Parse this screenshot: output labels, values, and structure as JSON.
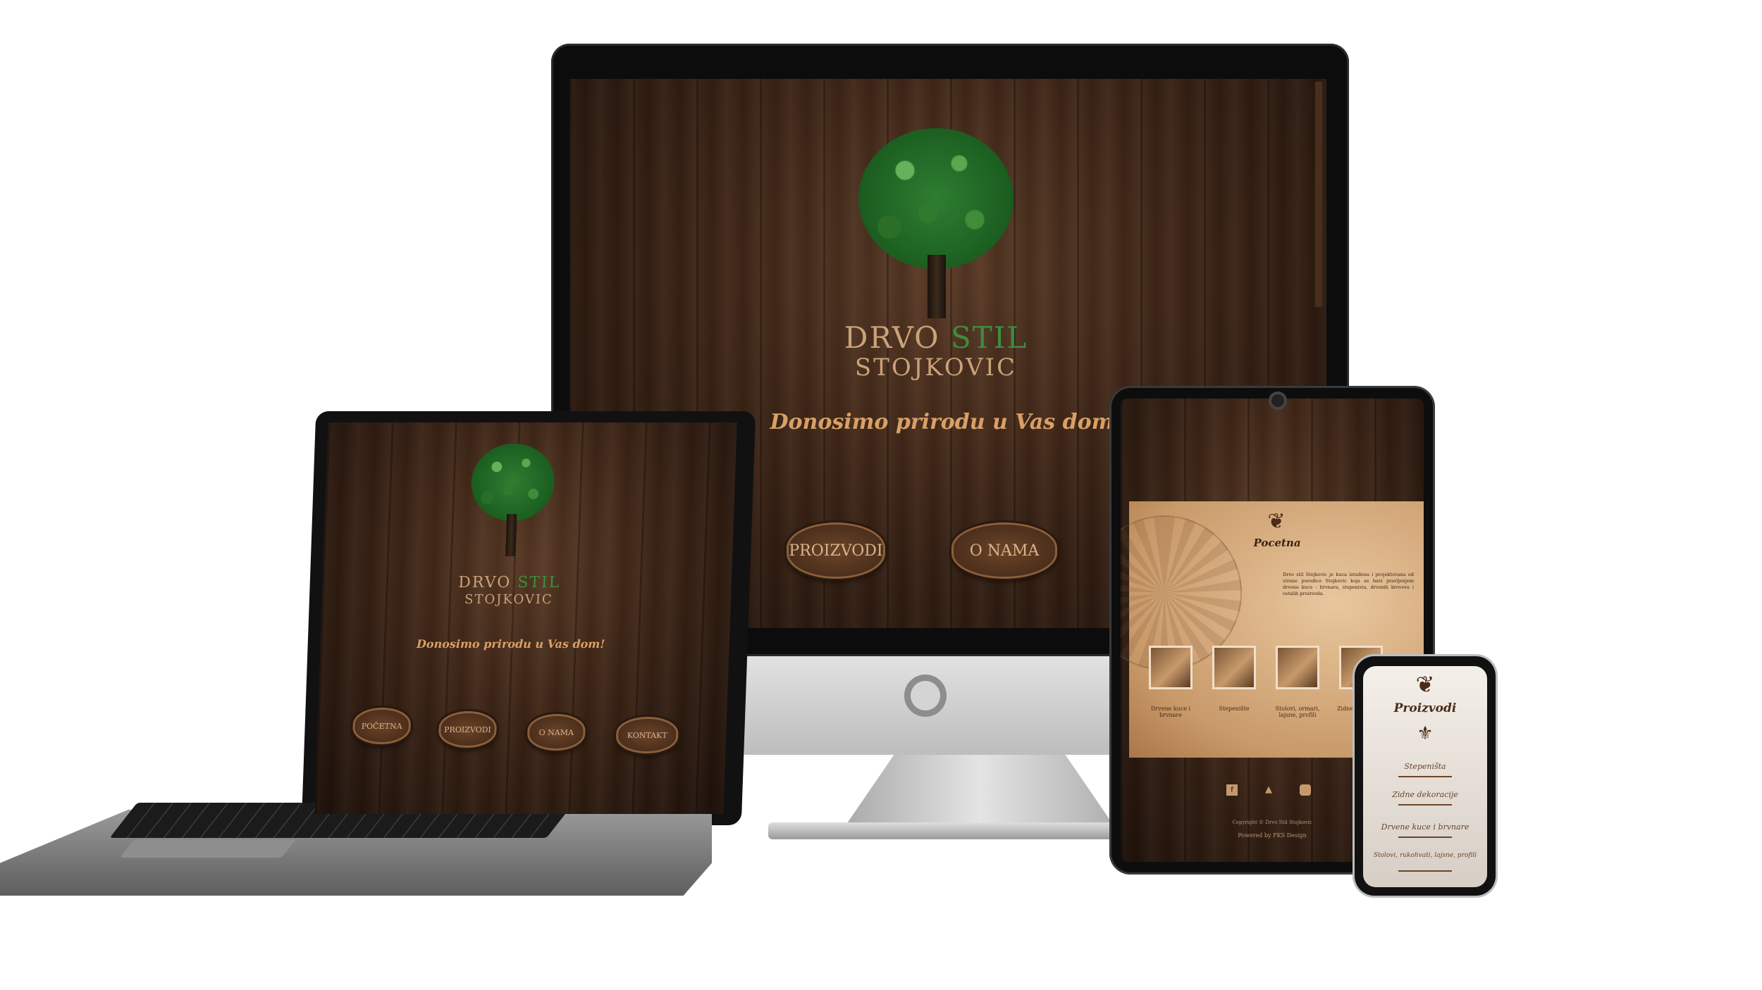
{
  "brand": {
    "name_part1": "DRVO",
    "name_part2": "STIL",
    "name_line2": "STOJKOVIC"
  },
  "tagline": "Donosimo prirodu u Vas dom!",
  "imac_nav": [
    "PROIZVODI",
    "O NAMA"
  ],
  "laptop_nav": [
    "POČETNA",
    "PROIZVODI",
    "O NAMA",
    "KONTAKT"
  ],
  "tablet": {
    "section_title": "Pocetna",
    "intro_text": "Drvo stil Stojkovic je kuca izrađena i projektovana od strane porodice Stojkovic koja se bavi pravljenjem drvene kuce - brvnara, stepenista, drvenih krovova i ostalih proizvoda.",
    "products": [
      "Drvene kuce i brvnare",
      "Stepenište",
      "Stolovi, ormari, lajsne, profili",
      "Zidne dekoracije"
    ],
    "footer_copyright": "Copyright © Drvo Stil Stojkovic",
    "footer_powered": "Powered by FKS Design"
  },
  "phone": {
    "section_title": "Proizvodi",
    "menu": [
      "Stepeništa",
      "Zidne dekoracije",
      "Drvene kuce i brvnare",
      "Stolovi, rukohvati, lajsne, profili"
    ]
  },
  "colors": {
    "wood_dark": "#1e110a",
    "wood_mid": "#3d2516",
    "gold_text": "#d9a066",
    "leaf_green": "#2e7d32",
    "stil_green": "#3d8d3d"
  }
}
